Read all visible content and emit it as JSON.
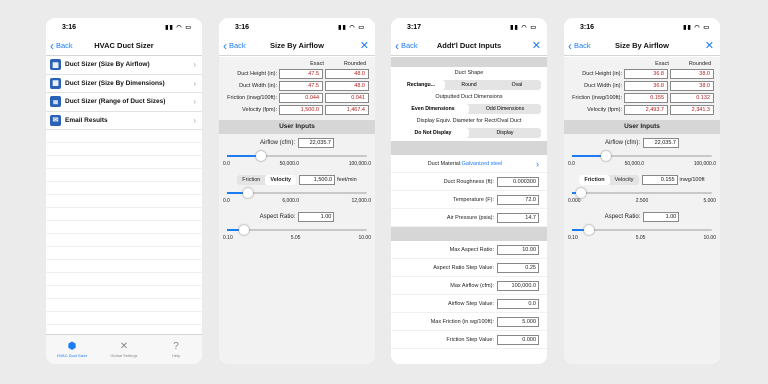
{
  "p1": {
    "time": "3:16",
    "back": "Back",
    "title": "HVAC Duct Sizer",
    "items": [
      {
        "label": "Duct Sizer (Size By Airflow)"
      },
      {
        "label": "Duct Sizer (Size By Dimensions)"
      },
      {
        "label": "Duct Sizer (Range of Duct Sizes)"
      },
      {
        "label": "Email Results"
      }
    ],
    "tabs": [
      "HVAC Duct Sizer",
      "Global Settings",
      "Help"
    ]
  },
  "p2": {
    "time": "3:16",
    "back": "Back",
    "title": "Size By Airflow",
    "col_exact": "Exact",
    "col_rounded": "Rounded",
    "rows": [
      {
        "label": "Duct Height (in):",
        "exact": "47.5",
        "rounded": "48.0"
      },
      {
        "label": "Duct Width (in):",
        "exact": "47.5",
        "rounded": "48.0"
      },
      {
        "label": "Friction (inwg/100ft):",
        "exact": "0.044",
        "rounded": "0.041"
      },
      {
        "label": "Velocity (fpm):",
        "exact": "1,500.0",
        "rounded": "1,467.4"
      }
    ],
    "user_inputs": "User Inputs",
    "airflow_label": "Airflow (cfm):",
    "airflow": "22,035.7",
    "airflow_ticks": [
      "0.0",
      "50,000.0",
      "100,000.0"
    ],
    "airflow_level": 0.22,
    "seg": [
      "Friction",
      "Velocity"
    ],
    "vel_value": "1,500.0",
    "vel_unit": "feet/min",
    "vel_ticks": [
      "0.0",
      "6,000.0",
      "12,000.0"
    ],
    "vel_level": 0.125,
    "aspect_label": "Aspect Ratio:",
    "aspect": "1.00",
    "aspect_ticks": [
      "0.10",
      "5.05",
      "10.00"
    ],
    "aspect_level": 0.09
  },
  "p3": {
    "time": "3:17",
    "back": "Back",
    "title": "Addt'l Duct Inputs",
    "shape_label": "Duct Shape",
    "shape_opts": [
      "Rectangu...",
      "Round",
      "Oval"
    ],
    "out_label": "Outputted Duct Dimensions",
    "out_opts": [
      "Even Dimensions",
      "Odd Dimensions"
    ],
    "disp_label": "Display Equiv. Diameter for Rect/Oval Duct",
    "disp_opts": [
      "Do Not Display",
      "Display"
    ],
    "material_label": "Duct Material:",
    "material_value": "Galvanized steel",
    "fields1": [
      {
        "label": "Duct Roughness (ft):",
        "value": "0.000300"
      },
      {
        "label": "Temperature (F):",
        "value": "72.0"
      },
      {
        "label": "Air Pressure (psia):",
        "value": "14.7"
      }
    ],
    "fields2": [
      {
        "label": "Max Aspect Ratio:",
        "value": "10.00"
      },
      {
        "label": "Aspect Ratio Step Value:",
        "value": "0.25"
      },
      {
        "label": "Max Airflow (cfm):",
        "value": "100,000.0"
      },
      {
        "label": "Airflow Step Value:",
        "value": "0.0"
      },
      {
        "label": "Max Friction (in wg/100ft):",
        "value": "5.000"
      },
      {
        "label": "Friction Step Value:",
        "value": "0.000"
      }
    ]
  },
  "p4": {
    "time": "3:16",
    "back": "Back",
    "title": "Size By Airflow",
    "col_exact": "Exact",
    "col_rounded": "Rounded",
    "rows": [
      {
        "label": "Duct Height (in):",
        "exact": "36.8",
        "rounded": "38.0"
      },
      {
        "label": "Duct Width (in):",
        "exact": "36.8",
        "rounded": "38.0"
      },
      {
        "label": "Friction (inwg/100ft):",
        "exact": "0.155",
        "rounded": "0.132"
      },
      {
        "label": "Velocity (fpm):",
        "exact": "2,493.7",
        "rounded": "2,341.3"
      }
    ],
    "user_inputs": "User Inputs",
    "airflow_label": "Airflow (cfm):",
    "airflow": "22,035.7",
    "airflow_ticks": [
      "0.0",
      "50,000.0",
      "100,000.0"
    ],
    "airflow_level": 0.22,
    "seg": [
      "Friction",
      "Velocity"
    ],
    "fr_value": "0.155",
    "fr_unit": "inwg/100ft",
    "fr_ticks": [
      "0.000",
      "2.500",
      "5.000"
    ],
    "fr_level": 0.03,
    "aspect_label": "Aspect Ratio:",
    "aspect": "1.00",
    "aspect_ticks": [
      "0.10",
      "5.05",
      "10.00"
    ],
    "aspect_level": 0.09
  }
}
